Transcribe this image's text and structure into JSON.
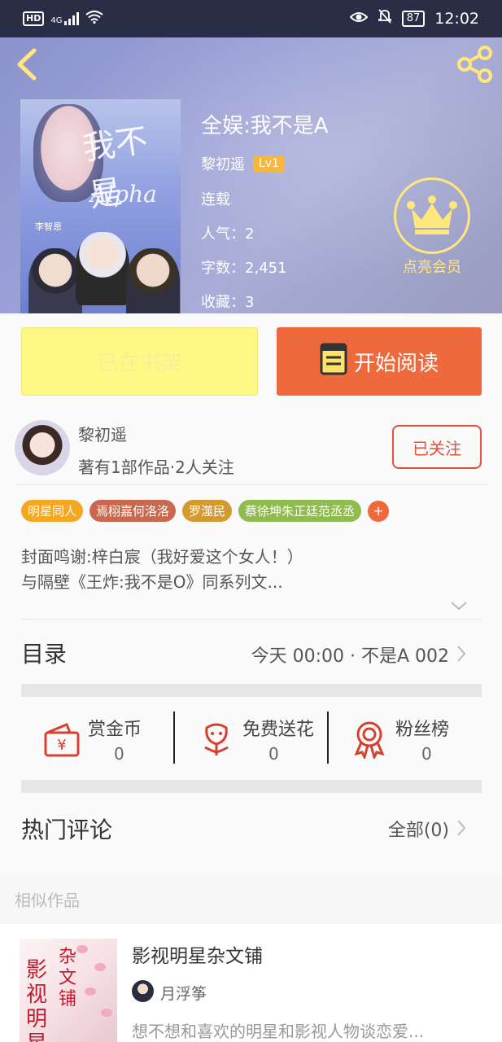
{
  "status_bar": {
    "hd": "HD",
    "network": "4G",
    "battery": "87",
    "time": "12:02"
  },
  "book": {
    "title": "全娱:我不是A",
    "author": "黎初遥",
    "level": "Lv1",
    "status": "连载",
    "popularity": "人气：2",
    "word_count": "字数：2,451",
    "favorites": "收藏：3"
  },
  "cover_art": {
    "title_text": "我不是",
    "alpha_text": "Alpha",
    "name_text": "李智恩"
  },
  "member": {
    "label": "点亮会员"
  },
  "actions": {
    "shelf_label": "已在书架",
    "read_label": "开始阅读"
  },
  "author_card": {
    "name": "黎初遥",
    "meta": "著有1部作品·2人关注",
    "follow_label": "已关注"
  },
  "tags": [
    {
      "label": "明星同人",
      "color": "#f5a623"
    },
    {
      "label": "焉栩嘉何洛洛",
      "color": "#c8694f"
    },
    {
      "label": "罗澨民",
      "color": "#d49a32"
    },
    {
      "label": "蔡徐坤朱正廷范丞丞",
      "color": "#8fbc4f"
    }
  ],
  "tag_more": "+",
  "description": {
    "line1": "封面鸣谢:梓白宸（我好爱这个女人！）",
    "line2": "与隔壁《王炸:我不是O》同系列文..."
  },
  "toc": {
    "title": "目录",
    "latest": "今天 00:00 · 不是A 002"
  },
  "stats": [
    {
      "label": "赏金币",
      "value": "0",
      "icon": "gold-coin-envelope-icon"
    },
    {
      "label": "免费送花",
      "value": "0",
      "icon": "flower-icon"
    },
    {
      "label": "粉丝榜",
      "value": "0",
      "icon": "medal-icon"
    }
  ],
  "comments": {
    "title": "热门评论",
    "all_label": "全部(0)"
  },
  "similar": {
    "section_title": "相似作品",
    "item": {
      "title": "影视明星杂文铺",
      "author": "月浮筝",
      "desc": "想不想和喜欢的明星和影视人物谈恋爱...",
      "cover_text_1": "影视明星",
      "cover_text_2": "杂文铺"
    }
  },
  "colors": {
    "accent_orange": "#ee6a3c",
    "shelf_yellow": "#fff884",
    "follow_red": "#e0523a",
    "member_gold": "#ffe77c",
    "level_badge": "#f6b73a"
  }
}
